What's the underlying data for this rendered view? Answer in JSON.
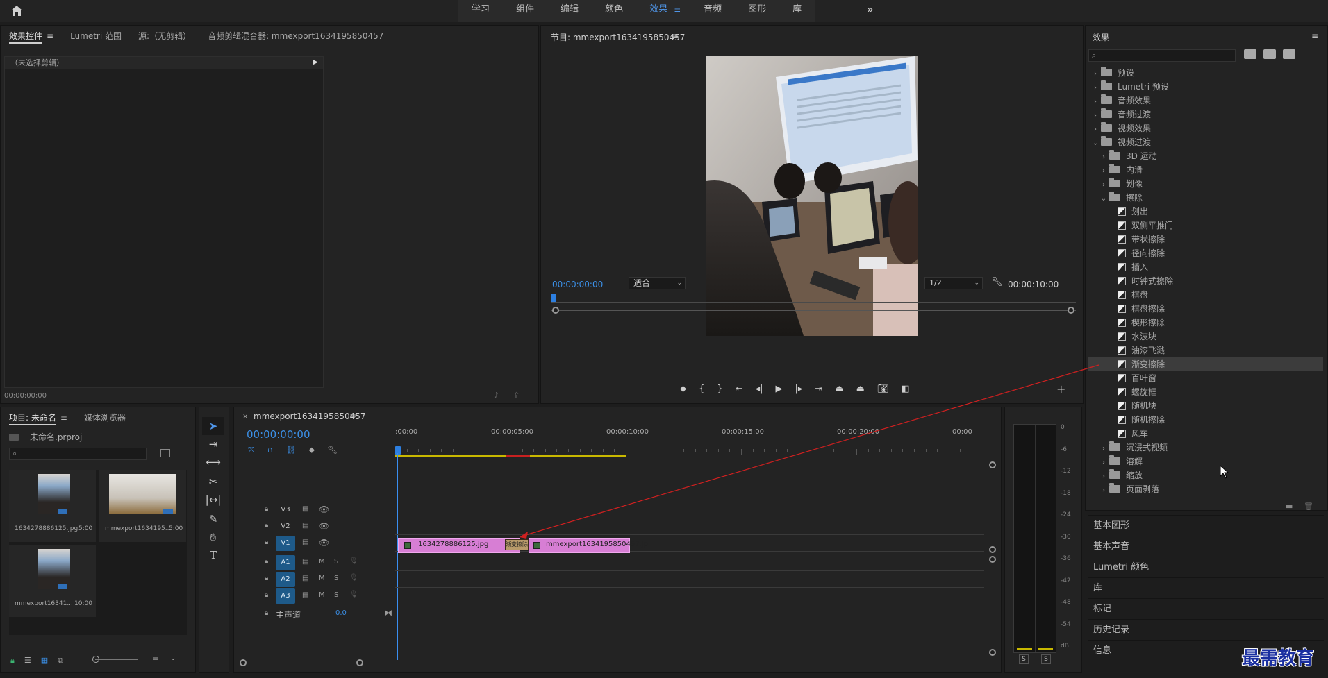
{
  "workspaces": {
    "items": [
      "学习",
      "组件",
      "编辑",
      "颜色",
      "效果",
      "音频",
      "图形",
      "库"
    ],
    "active": "效果"
  },
  "effect_controls": {
    "tabs": [
      "效果控件",
      "Lumetri 范围",
      "源:（无剪辑）",
      "音频剪辑混合器: mmexport1634195850457"
    ],
    "no_clip": "（未选择剪辑）",
    "timecode": "00:00:00:00"
  },
  "program": {
    "title": "节目: mmexport1634195850457",
    "timecode_in": "00:00:00:00",
    "fit": "适合",
    "resolution": "1/2",
    "timecode_out": "00:00:10:00"
  },
  "effects": {
    "title": "效果",
    "search_placeholder": "",
    "tree": [
      {
        "label": "预设",
        "level": 0,
        "kind": "folder",
        "open": false
      },
      {
        "label": "Lumetri 预设",
        "level": 0,
        "kind": "folder",
        "open": false
      },
      {
        "label": "音频效果",
        "level": 0,
        "kind": "folder",
        "open": false
      },
      {
        "label": "音频过渡",
        "level": 0,
        "kind": "folder",
        "open": false
      },
      {
        "label": "视频效果",
        "level": 0,
        "kind": "folder",
        "open": false
      },
      {
        "label": "视频过渡",
        "level": 0,
        "kind": "folder",
        "open": true
      },
      {
        "label": "3D 运动",
        "level": 1,
        "kind": "folder",
        "open": false
      },
      {
        "label": "内滑",
        "level": 1,
        "kind": "folder",
        "open": false
      },
      {
        "label": "划像",
        "level": 1,
        "kind": "folder",
        "open": false
      },
      {
        "label": "擦除",
        "level": 1,
        "kind": "folder",
        "open": true
      },
      {
        "label": "划出",
        "level": 2,
        "kind": "fx"
      },
      {
        "label": "双侧平推门",
        "level": 2,
        "kind": "fx"
      },
      {
        "label": "带状擦除",
        "level": 2,
        "kind": "fx"
      },
      {
        "label": "径向擦除",
        "level": 2,
        "kind": "fx"
      },
      {
        "label": "插入",
        "level": 2,
        "kind": "fx"
      },
      {
        "label": "时钟式擦除",
        "level": 2,
        "kind": "fx"
      },
      {
        "label": "棋盘",
        "level": 2,
        "kind": "fx"
      },
      {
        "label": "棋盘擦除",
        "level": 2,
        "kind": "fx"
      },
      {
        "label": "楔形擦除",
        "level": 2,
        "kind": "fx"
      },
      {
        "label": "水波块",
        "level": 2,
        "kind": "fx"
      },
      {
        "label": "油漆飞溅",
        "level": 2,
        "kind": "fx"
      },
      {
        "label": "渐变擦除",
        "level": 2,
        "kind": "fx",
        "selected": true
      },
      {
        "label": "百叶窗",
        "level": 2,
        "kind": "fx"
      },
      {
        "label": "螺旋框",
        "level": 2,
        "kind": "fx"
      },
      {
        "label": "随机块",
        "level": 2,
        "kind": "fx"
      },
      {
        "label": "随机擦除",
        "level": 2,
        "kind": "fx"
      },
      {
        "label": "风车",
        "level": 2,
        "kind": "fx"
      },
      {
        "label": "沉浸式视频",
        "level": 1,
        "kind": "folder",
        "open": false
      },
      {
        "label": "溶解",
        "level": 1,
        "kind": "folder",
        "open": false
      },
      {
        "label": "缩放",
        "level": 1,
        "kind": "folder",
        "open": false
      },
      {
        "label": "页面剥落",
        "level": 1,
        "kind": "folder",
        "open": false
      }
    ],
    "sections": [
      "基本图形",
      "基本声音",
      "Lumetri 颜色",
      "库",
      "标记",
      "历史记录",
      "信息"
    ]
  },
  "project": {
    "tabs": [
      "项目: 未命名",
      "媒体浏览器"
    ],
    "file": "未命名.prproj",
    "items": [
      {
        "name": "1634278886125.jpg",
        "duration": "5:00"
      },
      {
        "name": "mmexport1634195...",
        "duration": "5:00"
      },
      {
        "name": "mmexport16341...",
        "duration": "10:00"
      }
    ]
  },
  "timeline": {
    "sequence": "mmexport1634195850457",
    "timecode": "00:00:00:00",
    "ruler": [
      ":00:00",
      "00:00:05:00",
      "00:00:10:00",
      "00:00:15:00",
      "00:00:20:00",
      "00:00"
    ],
    "video_tracks": [
      "V3",
      "V2",
      "V1"
    ],
    "audio_tracks": [
      "A1",
      "A2",
      "A3"
    ],
    "master_label": "主声道",
    "master_value": "0.0",
    "clip1": "1634278886125.jpg",
    "clip2": "mmexport1634195850457.jp",
    "transition": "渐变擦除"
  },
  "meter": {
    "scale": [
      "0",
      "-6",
      "-12",
      "-18",
      "-24",
      "-30",
      "-36",
      "-42",
      "-48",
      "-54",
      "dB"
    ],
    "solo": [
      "S",
      "S"
    ]
  },
  "watermark": "最需教育"
}
